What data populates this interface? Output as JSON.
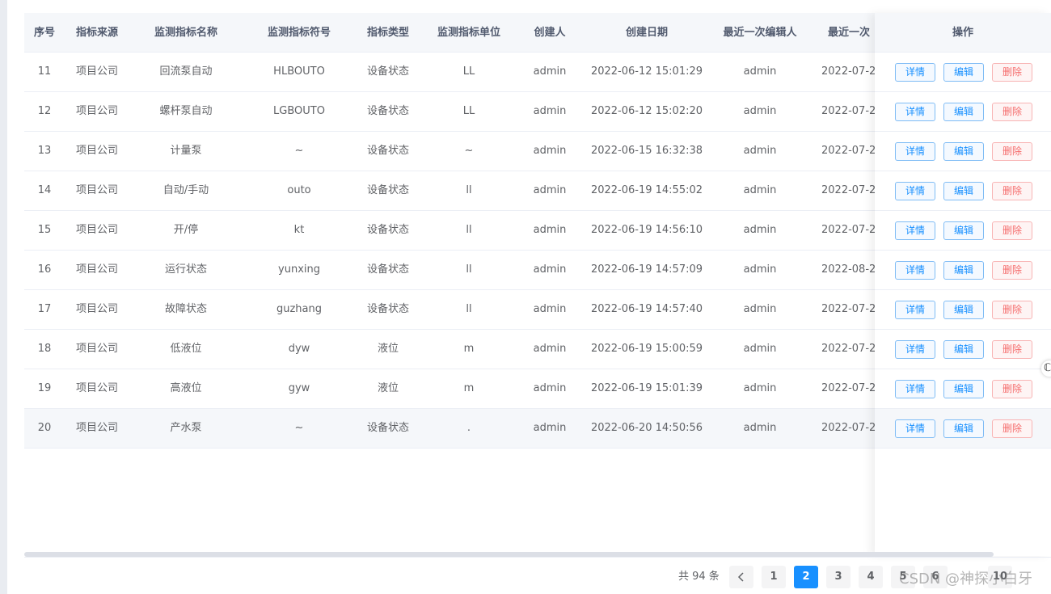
{
  "columns": [
    "序号",
    "指标来源",
    "监测指标名称",
    "监测指标符号",
    "指标类型",
    "监测指标单位",
    "创建人",
    "创建日期",
    "最近一次编辑人",
    "最近一次"
  ],
  "action_header": "操作",
  "rows": [
    {
      "cells": [
        "11",
        "项目公司",
        "回流泵自动",
        "HLBOUTO",
        "设备状态",
        "LL",
        "admin",
        "2022-06-12 15:01:29",
        "admin",
        "2022-07-2"
      ]
    },
    {
      "cells": [
        "12",
        "项目公司",
        "螺杆泵自动",
        "LGBOUTO",
        "设备状态",
        "LL",
        "admin",
        "2022-06-12 15:02:20",
        "admin",
        "2022-07-2"
      ]
    },
    {
      "cells": [
        "13",
        "项目公司",
        "计量泵",
        "~",
        "设备状态",
        "~",
        "admin",
        "2022-06-15 16:32:38",
        "admin",
        "2022-07-2"
      ]
    },
    {
      "cells": [
        "14",
        "项目公司",
        "自动/手动",
        "outo",
        "设备状态",
        "ll",
        "admin",
        "2022-06-19 14:55:02",
        "admin",
        "2022-07-2"
      ]
    },
    {
      "cells": [
        "15",
        "项目公司",
        "开/停",
        "kt",
        "设备状态",
        "ll",
        "admin",
        "2022-06-19 14:56:10",
        "admin",
        "2022-07-2"
      ]
    },
    {
      "cells": [
        "16",
        "项目公司",
        "运行状态",
        "yunxing",
        "设备状态",
        "ll",
        "admin",
        "2022-06-19 14:57:09",
        "admin",
        "2022-08-2"
      ]
    },
    {
      "cells": [
        "17",
        "项目公司",
        "故障状态",
        "guzhang",
        "设备状态",
        "ll",
        "admin",
        "2022-06-19 14:57:40",
        "admin",
        "2022-07-2"
      ]
    },
    {
      "cells": [
        "18",
        "项目公司",
        "低液位",
        "dyw",
        "液位",
        "m",
        "admin",
        "2022-06-19 15:00:59",
        "admin",
        "2022-07-2"
      ]
    },
    {
      "cells": [
        "19",
        "项目公司",
        "高液位",
        "gyw",
        "液位",
        "m",
        "admin",
        "2022-06-19 15:01:39",
        "admin",
        "2022-07-2"
      ]
    },
    {
      "cells": [
        "20",
        "项目公司",
        "产水泵",
        "~",
        "设备状态",
        ".",
        "admin",
        "2022-06-20 14:50:56",
        "admin",
        "2022-07-2"
      ]
    }
  ],
  "actions": {
    "detail": "详情",
    "edit": "编辑",
    "delete": "删除"
  },
  "pagination": {
    "total_text": "共 94 条",
    "prev_icon": "chevron-left-icon",
    "pages": [
      "1",
      "2",
      "3",
      "4",
      "5",
      "6",
      "10"
    ],
    "current_page": "2"
  },
  "watermark": "CSDN @神探小白牙",
  "colors": {
    "primary": "#1890ff",
    "danger": "#f56c6c",
    "header_bg": "#f5f7fa"
  }
}
